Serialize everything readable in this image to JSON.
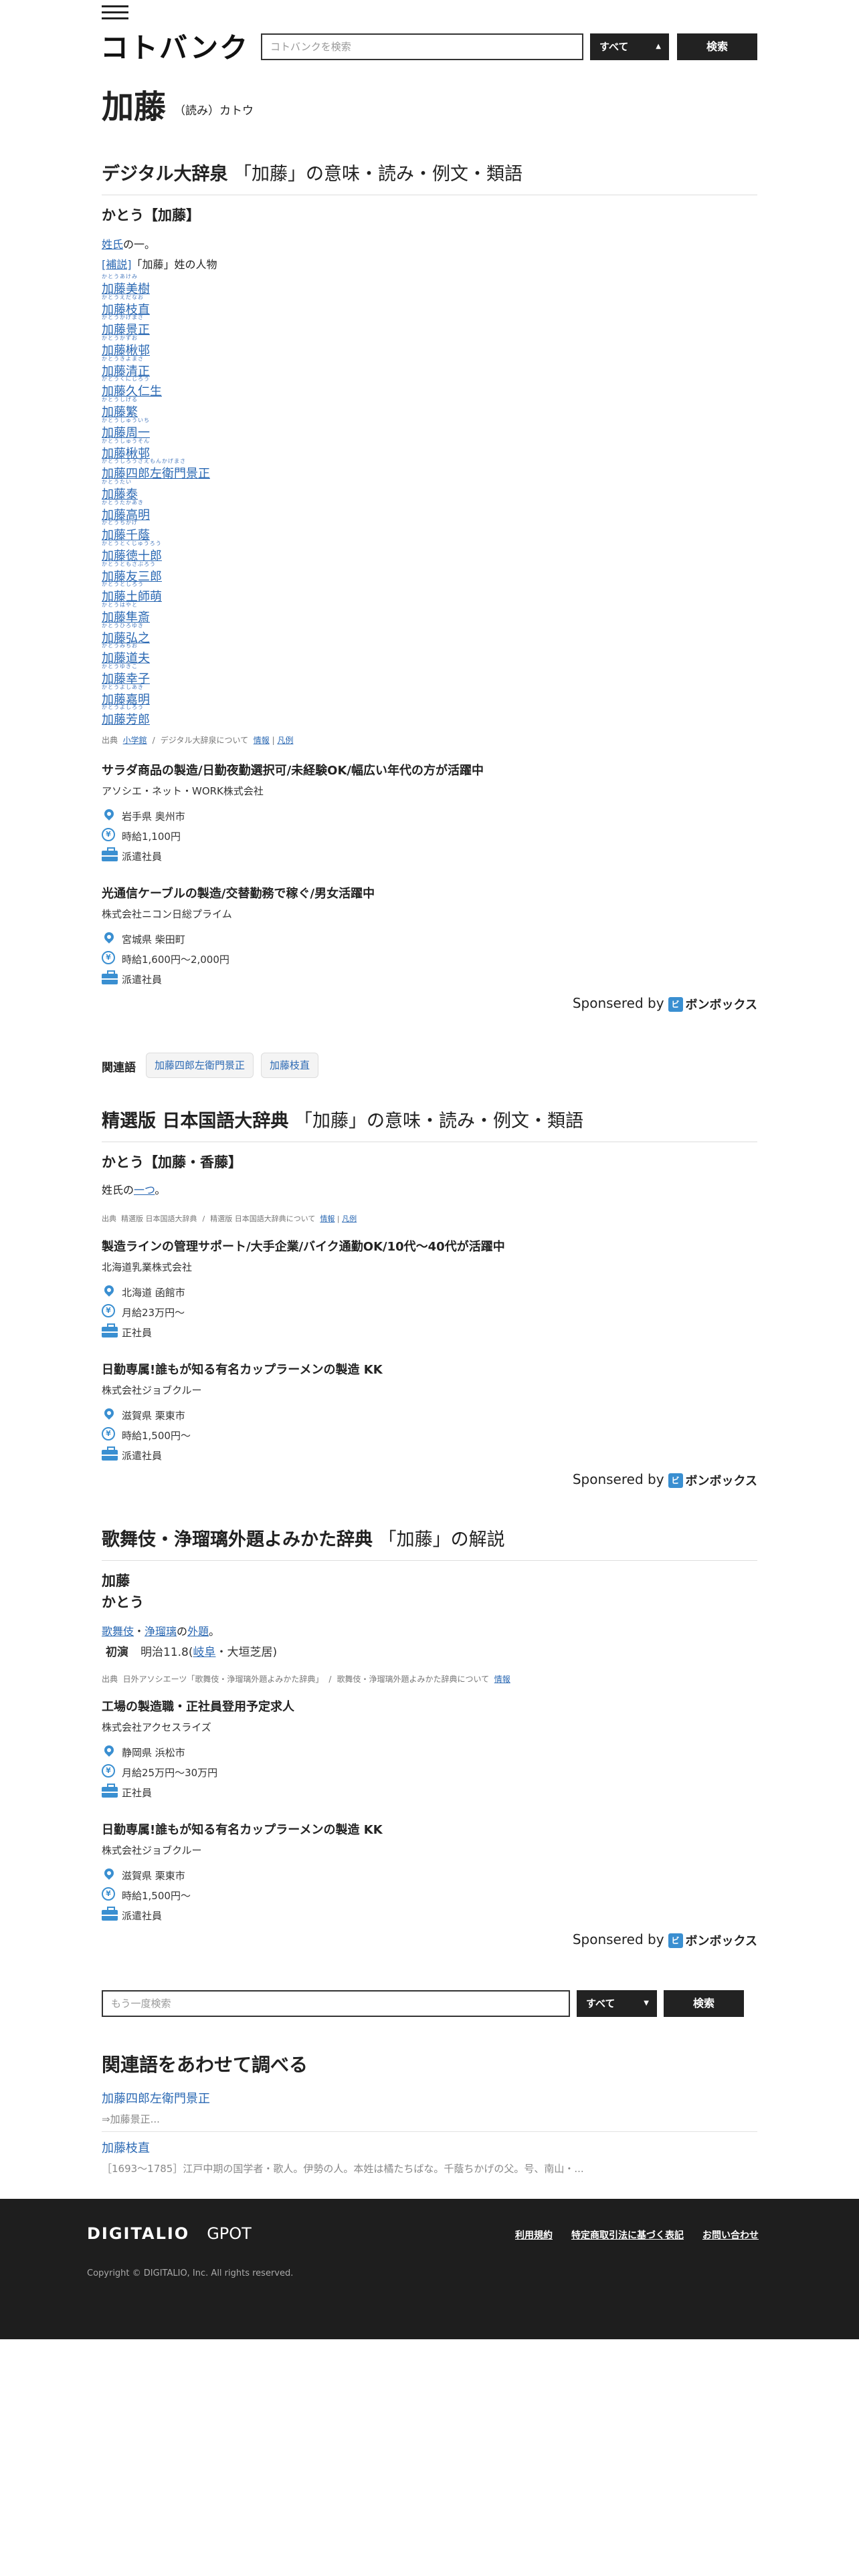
{
  "header": {
    "logo": "コトバンク",
    "search_placeholder": "コトバンクを検索",
    "scope": "すべて",
    "search_button": "検索"
  },
  "headword": {
    "title": "加藤",
    "reading": "（読み）カトウ"
  },
  "sec1": {
    "name": "デジタル大辞泉",
    "suffix": "「加藤」の意味・読み・例文・類語",
    "entry": "かとう【加藤】",
    "def_link": "姓氏",
    "def_rest": "の一。",
    "supp_link": "[補説]",
    "supp_rest": "「加藤」姓の人物",
    "names": [
      {
        "ruby": "かとうあけみ",
        "name": "加藤美樹"
      },
      {
        "ruby": "かとうえだなお",
        "name": "加藤枝直"
      },
      {
        "ruby": "かとうかげまさ",
        "name": "加藤景正"
      },
      {
        "ruby": "かとうかずお",
        "name": "加藤楸邨"
      },
      {
        "ruby": "かとうきよまさ",
        "name": "加藤清正"
      },
      {
        "ruby": "かとうくにじろう",
        "name": "加藤久仁生"
      },
      {
        "ruby": "かとうしげる",
        "name": "加藤繁"
      },
      {
        "ruby": "かとうしゅういち",
        "name": "加藤周一"
      },
      {
        "ruby": "かとうしゅうそん",
        "name": "加藤楸邨"
      },
      {
        "ruby": "かとうしろうざえもんかげまさ",
        "name": "加藤四郎左衛門景正"
      },
      {
        "ruby": "かとうたい",
        "name": "加藤泰"
      },
      {
        "ruby": "かとうたかあき",
        "name": "加藤高明"
      },
      {
        "ruby": "かとうちかげ",
        "name": "加藤千蔭"
      },
      {
        "ruby": "かとうとくじゅうろう",
        "name": "加藤徳十郎"
      },
      {
        "ruby": "かとうともさぶろう",
        "name": "加藤友三郎"
      },
      {
        "ruby": "かとうとしろう",
        "name": "加藤土師萌"
      },
      {
        "ruby": "かとうはやと",
        "name": "加藤隼斎"
      },
      {
        "ruby": "かとうひろゆき",
        "name": "加藤弘之"
      },
      {
        "ruby": "かとうみちお",
        "name": "加藤道夫"
      },
      {
        "ruby": "かとうゆきこ",
        "name": "加藤幸子"
      },
      {
        "ruby": "かとうよしあき",
        "name": "加藤嘉明"
      },
      {
        "ruby": "かとうよしろう",
        "name": "加藤芳郎"
      }
    ],
    "src_label": "出典",
    "src_pub": "小学館",
    "src_about": "デジタル大辞泉について",
    "src_info": "情報",
    "src_ex": "凡例"
  },
  "jobs1": [
    {
      "title": "サラダ商品の製造/日勤夜勤選択可/未経験OK/幅広い年代の方が活躍中",
      "company": "アソシエ・ネット・WORK株式会社",
      "place": "岩手県 奥州市",
      "wage": "時給1,100円",
      "type": "派遣社員"
    },
    {
      "title": "光通信ケーブルの製造/交替勤務で稼ぐ/男女活躍中",
      "company": "株式会社ニコン日総プライム",
      "place": "宮城県 柴田町",
      "wage": "時給1,600円〜2,000円",
      "type": "派遣社員"
    }
  ],
  "sponsor": {
    "label": "Sponsered by",
    "badge": "ビ",
    "brand": "ボンボックス"
  },
  "related": {
    "label": "関連語",
    "items": [
      "加藤四郎左衛門景正",
      "加藤枝直"
    ]
  },
  "sec2": {
    "name": "精選版 日本国語大辞典",
    "suffix": "「加藤」の意味・読み・例文・類語",
    "entry": "かとう【加藤・香藤】",
    "def_pre": "姓氏の",
    "def_link": "一つ",
    "def_post": "。",
    "src_label": "出典",
    "src_pub": "精選版 日本国語大辞典",
    "src_about": "精選版 日本国語大辞典について",
    "src_info": "情報",
    "src_ex": "凡例"
  },
  "jobs2": [
    {
      "title": "製造ラインの管理サポート/大手企業/バイク通勤OK/10代〜40代が活躍中",
      "company": "北海道乳業株式会社",
      "place": "北海道 函館市",
      "wage": "月給23万円〜",
      "type": "正社員"
    },
    {
      "title": "日勤専属!誰もが知る有名カップラーメンの製造 KK",
      "company": "株式会社ジョブクルー",
      "place": "滋賀県 栗東市",
      "wage": "時給1,500円〜",
      "type": "派遣社員"
    }
  ],
  "sec3": {
    "name": "歌舞伎・浄瑠璃外題よみかた辞典",
    "suffix": "「加藤」の解説",
    "entry": "加藤",
    "reading": "かとう",
    "l1": "歌舞伎",
    "dot": "・",
    "l2": "浄瑠璃",
    "no": "の",
    "l3": "外題",
    "end": "。",
    "premiere_label": "初演",
    "premiere_pre": "明治11.8(",
    "premiere_link": "岐阜",
    "premiere_post": "・大垣芝居)",
    "src_label": "出典",
    "src_pub": "日外アソシエーツ「歌舞伎・浄瑠璃外題よみかた辞典」",
    "src_about": "歌舞伎・浄瑠璃外題よみかた辞典について",
    "src_info": "情報"
  },
  "jobs3": [
    {
      "title": "工場の製造職・正社員登用予定求人",
      "company": "株式会社アクセスライズ",
      "place": "静岡県 浜松市",
      "wage": "月給25万円〜30万円",
      "type": "正社員"
    },
    {
      "title": "日勤専属!誰もが知る有名カップラーメンの製造 KK",
      "company": "株式会社ジョブクルー",
      "place": "滋賀県 栗東市",
      "wage": "時給1,500円〜",
      "type": "派遣社員"
    }
  ],
  "bottom_search": {
    "placeholder": "もう一度検索",
    "scope": "すべて",
    "button": "検索"
  },
  "related_section": {
    "title": "関連語をあわせて調べる",
    "items": [
      {
        "title": "加藤四郎左衛門景正",
        "desc": "⇒加藤景正..."
      },
      {
        "title": "加藤枝直",
        "desc": "［1693〜1785］江戸中期の国学者・歌人。伊勢の人。本姓は橘たちばな。千蔭ちかげの父。号、南山・..."
      }
    ]
  },
  "footer": {
    "logo": "DIGITALIO",
    "logo2": "GPOT",
    "links": [
      "利用規約",
      "特定商取引法に基づく表記",
      "お問い合わせ"
    ],
    "copyright": "Copyright © DIGITALIO, Inc. All rights reserved."
  }
}
